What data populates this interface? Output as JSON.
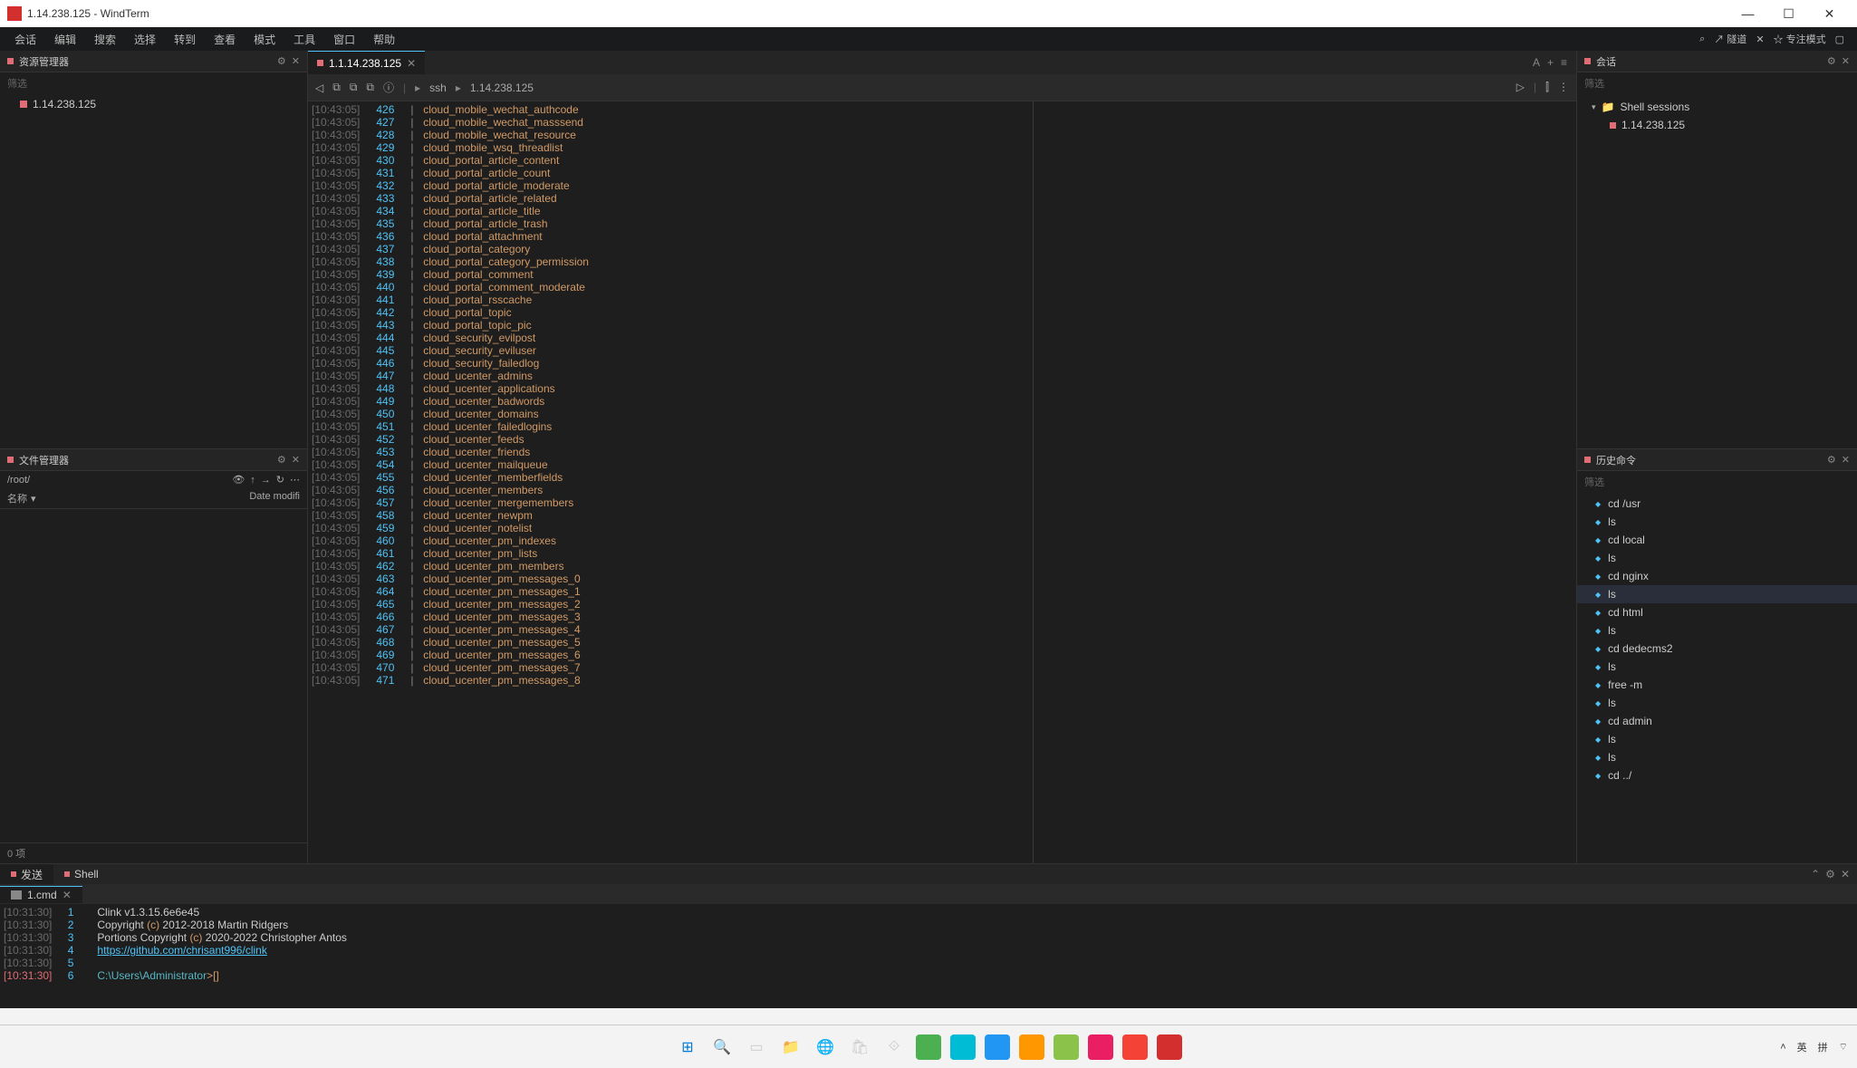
{
  "window": {
    "title": "1.14.238.125 - WindTerm"
  },
  "menu": [
    "会话",
    "编辑",
    "搜索",
    "选择",
    "转到",
    "查看",
    "模式",
    "工具",
    "窗口",
    "帮助"
  ],
  "top_right": {
    "search_icon": "⌕",
    "tunnel": "↗ 隧道",
    "x": "✕",
    "focus": "☆ 专注模式",
    "sq": "▢"
  },
  "left": {
    "explorer_title": "资源管理器",
    "filter_placeholder": "筛选",
    "host": "1.14.238.125",
    "file_title": "文件管理器",
    "path": "/root/",
    "col_name": "名称",
    "col_date": "Date modifi",
    "item_count": "0 项"
  },
  "center": {
    "tab_label": "1.1.14.238.125",
    "crumb_ssh": "ssh",
    "crumb_host": "1.14.238.125",
    "lines": [
      {
        "ts": "[10:43:05]",
        "n": "426",
        "t": "cloud_mobile_wechat_authcode"
      },
      {
        "ts": "[10:43:05]",
        "n": "427",
        "t": "cloud_mobile_wechat_masssend"
      },
      {
        "ts": "[10:43:05]",
        "n": "428",
        "t": "cloud_mobile_wechat_resource"
      },
      {
        "ts": "[10:43:05]",
        "n": "429",
        "t": "cloud_mobile_wsq_threadlist"
      },
      {
        "ts": "[10:43:05]",
        "n": "430",
        "t": "cloud_portal_article_content"
      },
      {
        "ts": "[10:43:05]",
        "n": "431",
        "t": "cloud_portal_article_count"
      },
      {
        "ts": "[10:43:05]",
        "n": "432",
        "t": "cloud_portal_article_moderate"
      },
      {
        "ts": "[10:43:05]",
        "n": "433",
        "t": "cloud_portal_article_related"
      },
      {
        "ts": "[10:43:05]",
        "n": "434",
        "t": "cloud_portal_article_title"
      },
      {
        "ts": "[10:43:05]",
        "n": "435",
        "t": "cloud_portal_article_trash"
      },
      {
        "ts": "[10:43:05]",
        "n": "436",
        "t": "cloud_portal_attachment"
      },
      {
        "ts": "[10:43:05]",
        "n": "437",
        "t": "cloud_portal_category"
      },
      {
        "ts": "[10:43:05]",
        "n": "438",
        "t": "cloud_portal_category_permission"
      },
      {
        "ts": "[10:43:05]",
        "n": "439",
        "t": "cloud_portal_comment"
      },
      {
        "ts": "[10:43:05]",
        "n": "440",
        "t": "cloud_portal_comment_moderate"
      },
      {
        "ts": "[10:43:05]",
        "n": "441",
        "t": "cloud_portal_rsscache"
      },
      {
        "ts": "[10:43:05]",
        "n": "442",
        "t": "cloud_portal_topic"
      },
      {
        "ts": "[10:43:05]",
        "n": "443",
        "t": "cloud_portal_topic_pic"
      },
      {
        "ts": "[10:43:05]",
        "n": "444",
        "t": "cloud_security_evilpost"
      },
      {
        "ts": "[10:43:05]",
        "n": "445",
        "t": "cloud_security_eviluser"
      },
      {
        "ts": "[10:43:05]",
        "n": "446",
        "t": "cloud_security_failedlog"
      },
      {
        "ts": "[10:43:05]",
        "n": "447",
        "t": "cloud_ucenter_admins"
      },
      {
        "ts": "[10:43:05]",
        "n": "448",
        "t": "cloud_ucenter_applications"
      },
      {
        "ts": "[10:43:05]",
        "n": "449",
        "t": "cloud_ucenter_badwords"
      },
      {
        "ts": "[10:43:05]",
        "n": "450",
        "t": "cloud_ucenter_domains"
      },
      {
        "ts": "[10:43:05]",
        "n": "451",
        "t": "cloud_ucenter_failedlogins"
      },
      {
        "ts": "[10:43:05]",
        "n": "452",
        "t": "cloud_ucenter_feeds"
      },
      {
        "ts": "[10:43:05]",
        "n": "453",
        "t": "cloud_ucenter_friends"
      },
      {
        "ts": "[10:43:05]",
        "n": "454",
        "t": "cloud_ucenter_mailqueue"
      },
      {
        "ts": "[10:43:05]",
        "n": "455",
        "t": "cloud_ucenter_memberfields"
      },
      {
        "ts": "[10:43:05]",
        "n": "456",
        "t": "cloud_ucenter_members"
      },
      {
        "ts": "[10:43:05]",
        "n": "457",
        "t": "cloud_ucenter_mergemembers"
      },
      {
        "ts": "[10:43:05]",
        "n": "458",
        "t": "cloud_ucenter_newpm"
      },
      {
        "ts": "[10:43:05]",
        "n": "459",
        "t": "cloud_ucenter_notelist"
      },
      {
        "ts": "[10:43:05]",
        "n": "460",
        "t": "cloud_ucenter_pm_indexes"
      },
      {
        "ts": "[10:43:05]",
        "n": "461",
        "t": "cloud_ucenter_pm_lists"
      },
      {
        "ts": "[10:43:05]",
        "n": "462",
        "t": "cloud_ucenter_pm_members"
      },
      {
        "ts": "[10:43:05]",
        "n": "463",
        "t": "cloud_ucenter_pm_messages_0"
      },
      {
        "ts": "[10:43:05]",
        "n": "464",
        "t": "cloud_ucenter_pm_messages_1"
      },
      {
        "ts": "[10:43:05]",
        "n": "465",
        "t": "cloud_ucenter_pm_messages_2"
      },
      {
        "ts": "[10:43:05]",
        "n": "466",
        "t": "cloud_ucenter_pm_messages_3"
      },
      {
        "ts": "[10:43:05]",
        "n": "467",
        "t": "cloud_ucenter_pm_messages_4"
      },
      {
        "ts": "[10:43:05]",
        "n": "468",
        "t": "cloud_ucenter_pm_messages_5"
      },
      {
        "ts": "[10:43:05]",
        "n": "469",
        "t": "cloud_ucenter_pm_messages_6"
      },
      {
        "ts": "[10:43:05]",
        "n": "470",
        "t": "cloud_ucenter_pm_messages_7"
      },
      {
        "ts": "[10:43:05]",
        "n": "471",
        "t": "cloud_ucenter_pm_messages_8"
      }
    ]
  },
  "right": {
    "session_title": "会话",
    "filter_placeholder": "筛选",
    "folder": "Shell sessions",
    "host": "1.14.238.125",
    "history_title": "历史命令",
    "history": [
      {
        "cmd": "cd /usr",
        "sel": false
      },
      {
        "cmd": "ls",
        "sel": false
      },
      {
        "cmd": "cd local",
        "sel": false
      },
      {
        "cmd": "ls",
        "sel": false
      },
      {
        "cmd": "cd nginx",
        "sel": false
      },
      {
        "cmd": "ls",
        "sel": true
      },
      {
        "cmd": "cd html",
        "sel": false
      },
      {
        "cmd": "ls",
        "sel": false
      },
      {
        "cmd": "cd dedecms2",
        "sel": false
      },
      {
        "cmd": "ls",
        "sel": false
      },
      {
        "cmd": "free -m",
        "sel": false
      },
      {
        "cmd": "ls",
        "sel": false
      },
      {
        "cmd": "cd admin",
        "sel": false
      },
      {
        "cmd": "ls",
        "sel": false
      },
      {
        "cmd": "ls",
        "sel": false
      },
      {
        "cmd": "cd ../",
        "sel": false
      }
    ]
  },
  "bottom": {
    "tab_send": "发送",
    "tab_shell": "Shell",
    "sub_tab": "1.cmd",
    "lines": [
      {
        "ts": "[10:31:30]",
        "n": "1",
        "parts": [
          {
            "c": "txt",
            "t": "Clink v1.3.15.6e6e45"
          }
        ]
      },
      {
        "ts": "[10:31:30]",
        "n": "2",
        "parts": [
          {
            "c": "txt",
            "t": "Copyright "
          },
          {
            "c": "paren",
            "t": "(c)"
          },
          {
            "c": "txt",
            "t": " 2012-2018 Martin Ridgers"
          }
        ]
      },
      {
        "ts": "[10:31:30]",
        "n": "3",
        "parts": [
          {
            "c": "txt",
            "t": "Portions Copyright "
          },
          {
            "c": "paren",
            "t": "(c)"
          },
          {
            "c": "txt",
            "t": " 2020-2022 Christopher Antos"
          }
        ]
      },
      {
        "ts": "[10:31:30]",
        "n": "4",
        "parts": [
          {
            "c": "link",
            "t": "https://github.com/chrisant996/clink"
          }
        ]
      },
      {
        "ts": "[10:31:30]",
        "n": "5",
        "parts": []
      },
      {
        "ts": "[10:31:30]",
        "n": "6",
        "red": true,
        "parts": [
          {
            "c": "prompt",
            "t": "C:\\Users\\Administrator"
          },
          {
            "c": "caret",
            "t": ">"
          },
          {
            "c": "paren",
            "t": "[]"
          }
        ]
      }
    ]
  },
  "tray": {
    "ime1": "英",
    "ime2": "拼",
    "wifi": "⌔"
  }
}
